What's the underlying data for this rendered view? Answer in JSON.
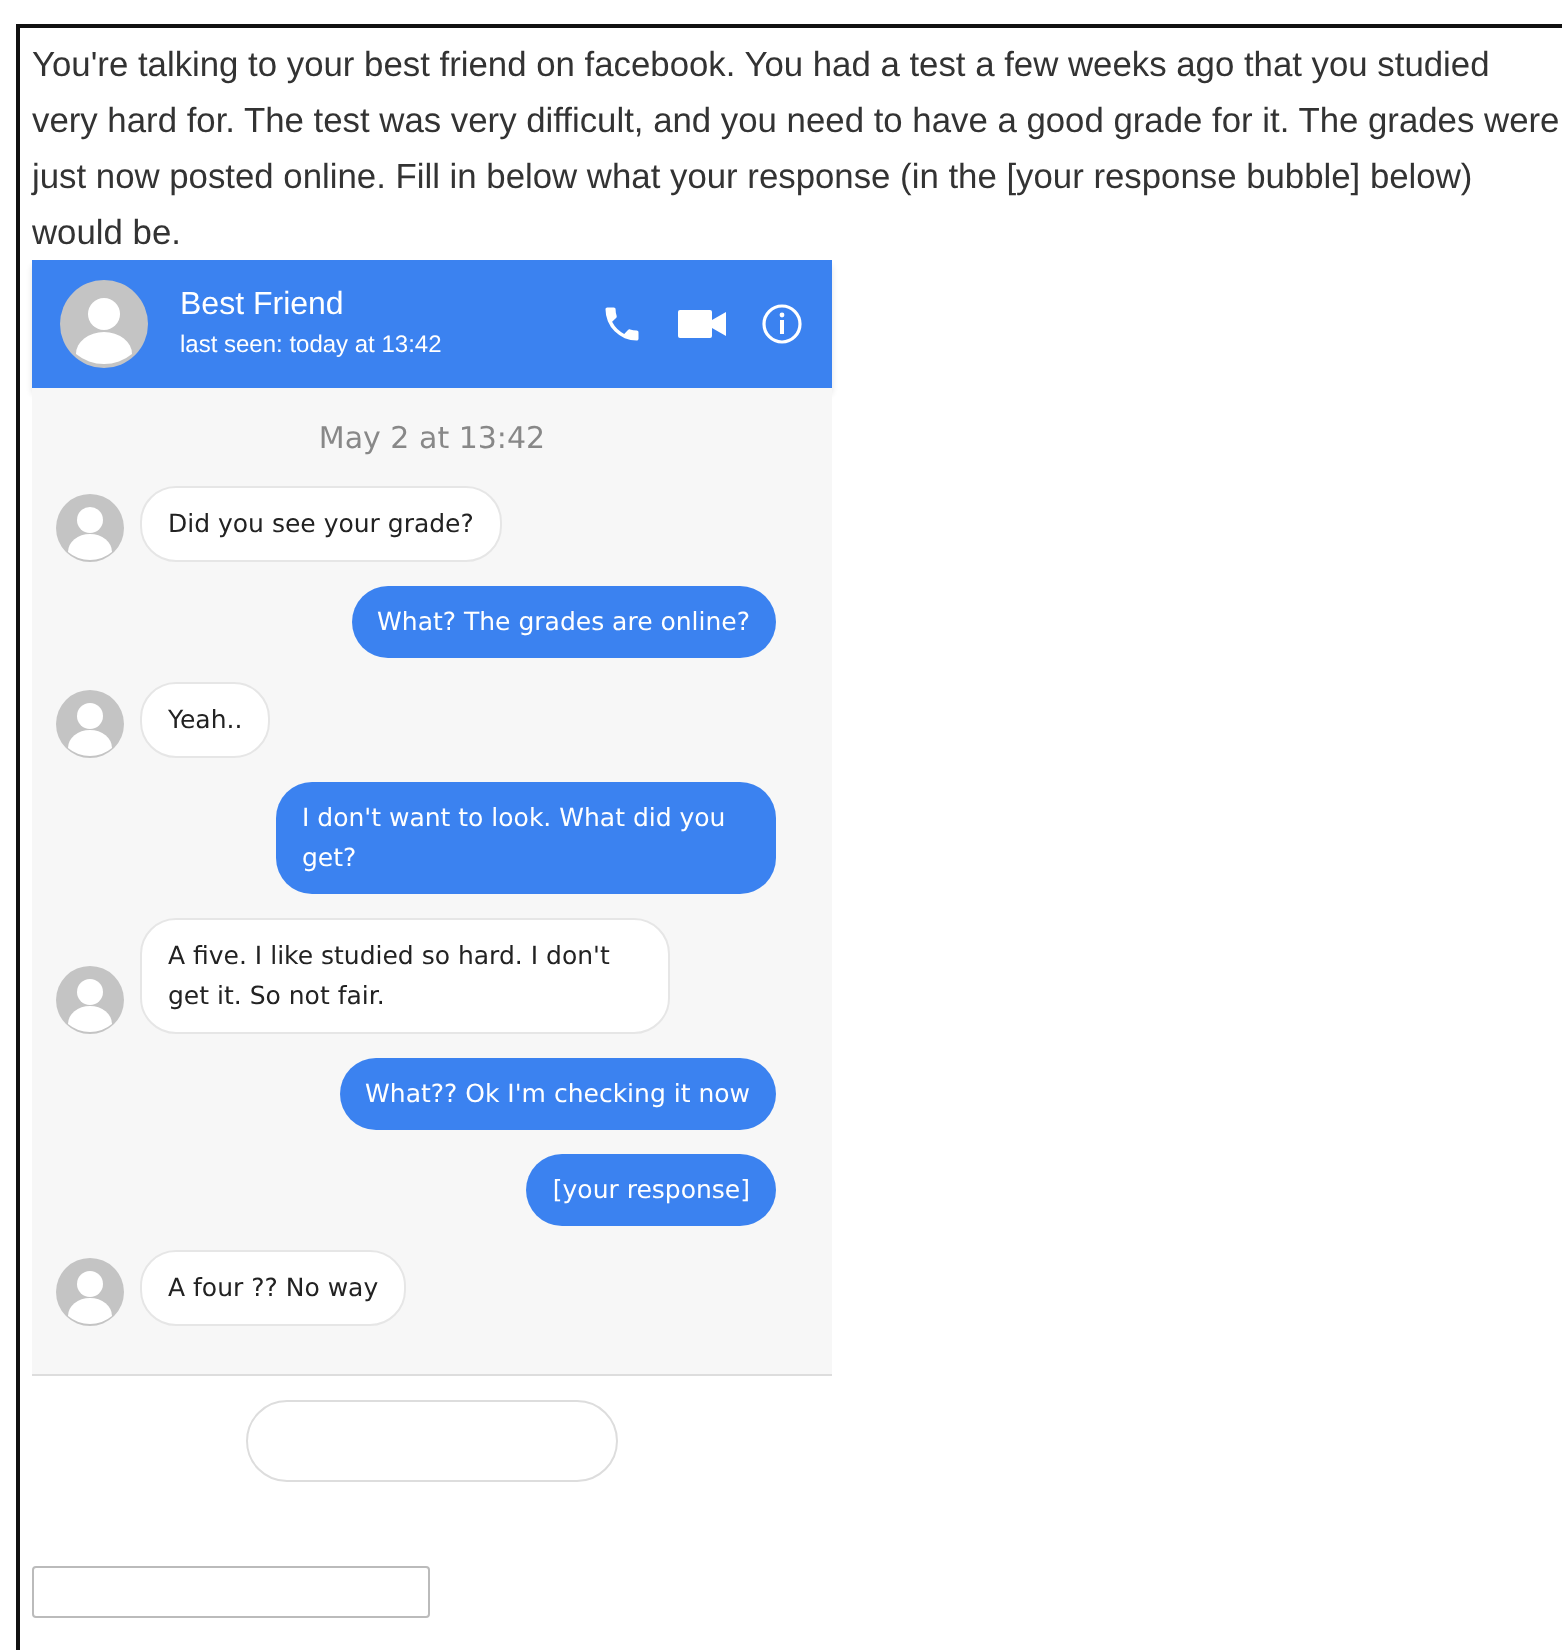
{
  "instructions": "You're talking to your best friend on facebook. You had a test a few weeks ago that you studied very hard for. The test was very difficult, and you need to have a good grade for it. The grades were just now posted online. Fill in below what your response (in the [your response bubble] below) would be.",
  "chat": {
    "contact_name": "Best Friend",
    "last_seen": "last seen: today at 13:42",
    "date_stamp": "May 2 at 13:42",
    "messages": [
      {
        "kind": "received",
        "text": "Did you see your grade?"
      },
      {
        "kind": "sent",
        "text": "What? The grades are online?"
      },
      {
        "kind": "received",
        "text": "Yeah.."
      },
      {
        "kind": "sent",
        "text": "I don't want to look. What did you get?"
      },
      {
        "kind": "received",
        "text": "A five. I like studied so hard. I don't get it. So not fair."
      },
      {
        "kind": "sent",
        "text": "What?? Ok I'm checking it now"
      },
      {
        "kind": "sent",
        "text": "[your response]"
      },
      {
        "kind": "received",
        "text": "A four ?? No way"
      }
    ]
  }
}
